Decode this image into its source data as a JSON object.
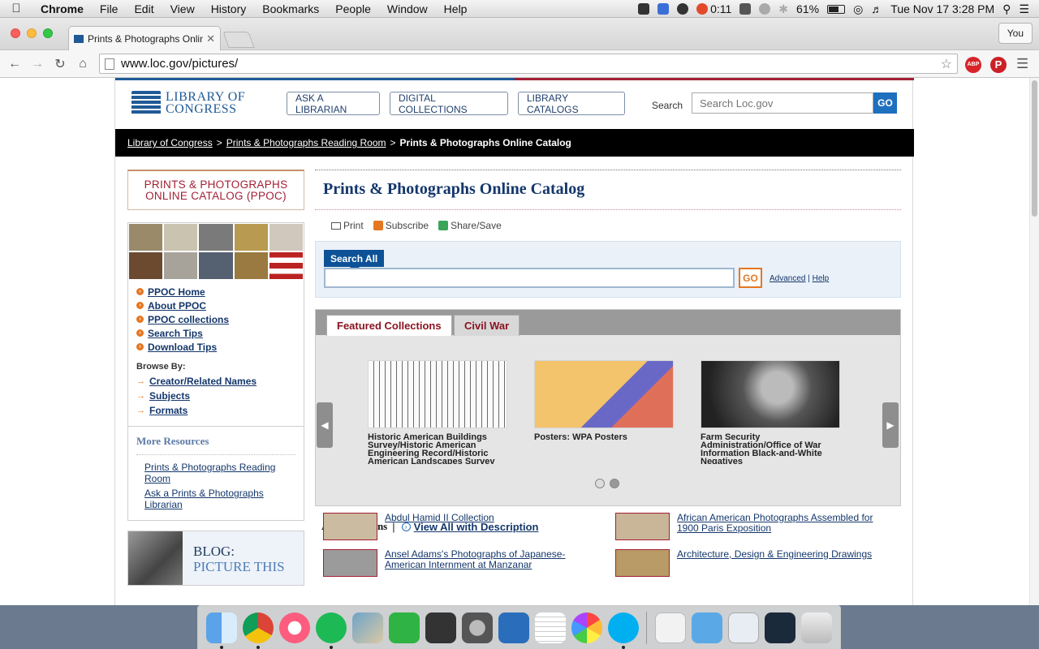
{
  "menubar": {
    "app": "Chrome",
    "items": [
      "File",
      "Edit",
      "View",
      "History",
      "Bookmarks",
      "People",
      "Window",
      "Help"
    ],
    "timer": "0:11",
    "battery": "61%",
    "clock": "Tue Nov 17  3:28 PM"
  },
  "browser": {
    "tab_title": "Prints & Photographs Onlin",
    "profile": "You",
    "url": "www.loc.gov/pictures/"
  },
  "header": {
    "logo": "LIBRARY OF CONGRESS",
    "buttons": [
      "ASK A LIBRARIAN",
      "DIGITAL COLLECTIONS",
      "LIBRARY CATALOGS"
    ],
    "search_label": "Search",
    "search_placeholder": "Search Loc.gov",
    "go": "GO"
  },
  "breadcrumb": [
    "Library of Congress",
    "Prints & Photographs Reading Room",
    "Prints & Photographs Online Catalog"
  ],
  "sidebar": {
    "title": "PRINTS & PHOTOGRAPHS ONLINE CATALOG (PPOC)",
    "nav": [
      "PPOC Home",
      "About PPOC",
      "PPOC collections",
      "Search Tips",
      "Download Tips"
    ],
    "browse_label": "Browse By:",
    "browse": [
      "Creator/Related Names",
      "Subjects",
      "Formats"
    ],
    "more_title": "More Resources",
    "more": [
      "Prints & Photographs Reading Room",
      "Ask a Prints & Photographs Librarian"
    ],
    "blog_line1": "BLOG:",
    "blog_line2": "PICTURE THIS"
  },
  "main": {
    "title": "Prints & Photographs Online Catalog",
    "tools": [
      "Print",
      "Subscribe",
      "Share/Save"
    ],
    "search_tab": "Search All",
    "search_go": "GO",
    "advanced": "Advanced",
    "help": "Help",
    "tabs": [
      "Featured Collections",
      "Civil War"
    ],
    "featured": [
      "Historic American Buildings Survey/Historic American Engineering Record/Historic American Landscapes Survey",
      "Posters: WPA Posters",
      "Farm Security Administration/Office of War Information Black-and-White Negatives"
    ],
    "all_label": "All Collections",
    "view_all": "View All with Description",
    "collections": [
      "Abdul Hamid II Collection",
      "African American Photographs Assembled for 1900 Paris Exposition",
      "Ansel Adams's Photographs of Japanese-American Internment at Manzanar",
      "Architecture, Design & Engineering Drawings"
    ]
  }
}
